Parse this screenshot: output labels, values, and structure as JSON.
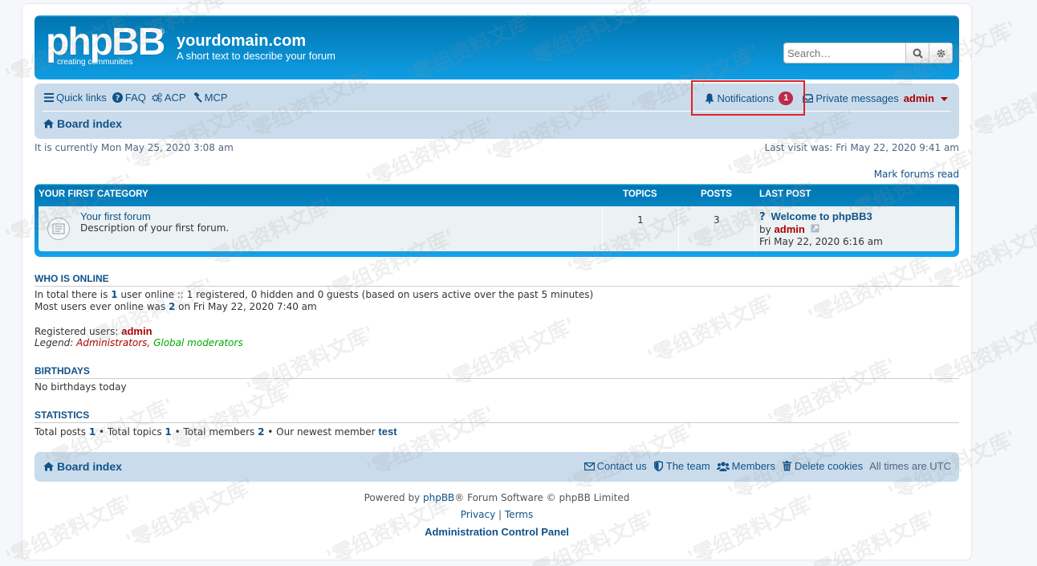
{
  "header": {
    "logo_text": "phpBB",
    "logo_tagline": "creating   communities",
    "site_name": "yourdomain.com",
    "site_desc": "A short text to describe your forum",
    "search_placeholder": "Search…"
  },
  "navbar": {
    "quick_links": "Quick links",
    "faq": "FAQ",
    "acp": "ACP",
    "mcp": "MCP",
    "notifications": "Notifications",
    "notifications_count": "1",
    "private_messages": "Private messages",
    "username": "admin",
    "breadcrumb": "Board index"
  },
  "status": {
    "current_time": "It is currently Mon May 25, 2020 3:08 am",
    "last_visit": "Last visit was: Fri May 22, 2020 9:41 am",
    "mark_read": "Mark forums read"
  },
  "forum_table": {
    "category": "Your first category",
    "col_topics": "Topics",
    "col_posts": "Posts",
    "col_lastpost": "Last post",
    "rows": [
      {
        "title": "Your first forum",
        "description": "Description of your first forum.",
        "topics": "1",
        "posts": "3",
        "lastpost_title": "Welcome to phpBB3",
        "lastpost_by": "by",
        "lastpost_author": "admin",
        "lastpost_date": "Fri May 22, 2020 6:16 am"
      }
    ]
  },
  "who_is_online": {
    "title": "Who is online",
    "line1_pre": "In total there is ",
    "line1_count": "1",
    "line1_post": " user online :: 1 registered, 0 hidden and 0 guests (based on users active over the past 5 minutes)",
    "line2_pre": "Most users ever online was ",
    "line2_count": "2",
    "line2_post": " on Fri May 22, 2020 7:40 am",
    "registered_label": "Registered users: ",
    "registered_user": "admin",
    "legend_label": "Legend: ",
    "legend_admins": "Administrators",
    "legend_sep": ", ",
    "legend_mods": "Global moderators"
  },
  "birthdays": {
    "title": "Birthdays",
    "text": "No birthdays today"
  },
  "statistics": {
    "title": "Statistics",
    "p1": "Total posts ",
    "v1": "1",
    "p2": " • Total topics ",
    "v2": "1",
    "p3": " • Total members ",
    "v3": "2",
    "p4": " • Our newest member ",
    "v4": "test"
  },
  "footer": {
    "board_index": "Board index",
    "contact": "Contact us",
    "team": "The team",
    "members": "Members",
    "delete_cookies": "Delete cookies",
    "timezone": "All times are UTC",
    "powered_pre": "Powered by ",
    "powered_link": "phpBB",
    "powered_post": "® Forum Software © phpBB Limited",
    "privacy": "Privacy",
    "sep": " | ",
    "terms": "Terms",
    "acp": "Administration Control Panel"
  },
  "watermark": "'零组资料文库'",
  "colors": {
    "header_blue": "#12a3eb",
    "navbar_bg": "#cadceb",
    "link": "#105289",
    "admin_red": "#aa0000",
    "badge": "#bc2a4d",
    "highlight": "#e02222"
  }
}
